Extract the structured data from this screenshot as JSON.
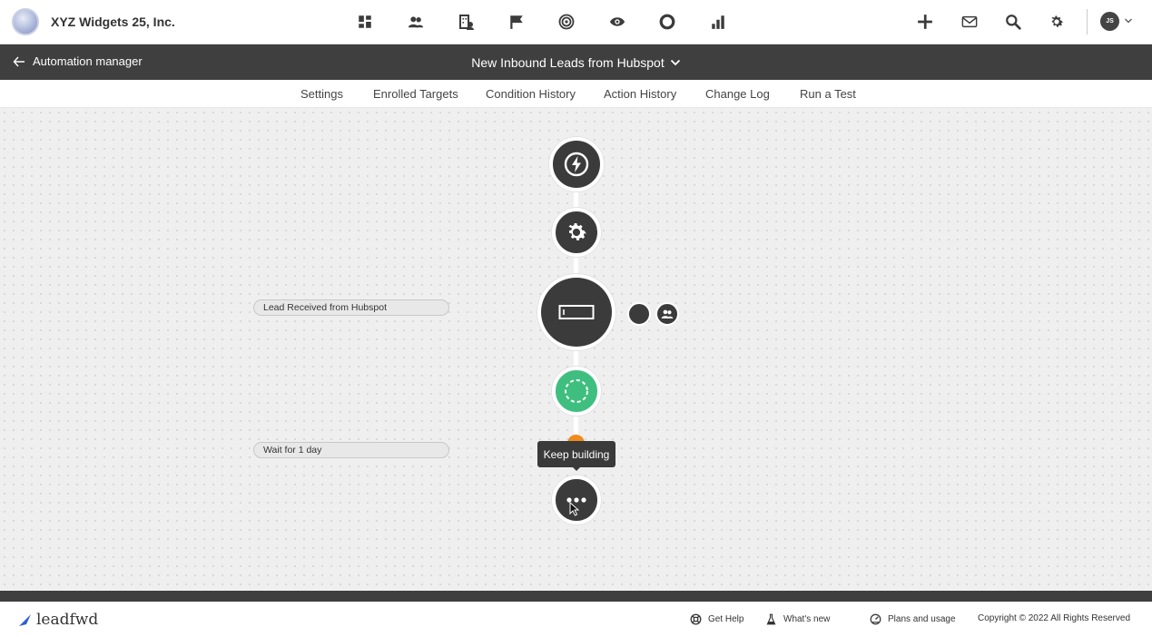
{
  "header": {
    "company_name": "XYZ Widgets 25, Inc.",
    "nav_icons": [
      "dashboard-icon",
      "contacts-icon",
      "accounts-icon",
      "flag-icon",
      "target-icon",
      "eye-icon",
      "circle-icon",
      "bar-chart-icon"
    ],
    "right_icons": [
      "plus-icon",
      "mail-icon",
      "search-icon",
      "gear-icon"
    ],
    "user_initials": "JS"
  },
  "subheader": {
    "back_label": "Automation manager",
    "workflow_title": "New Inbound Leads from Hubspot"
  },
  "tabs": [
    {
      "label": "Settings"
    },
    {
      "label": "Enrolled Targets"
    },
    {
      "label": "Condition History"
    },
    {
      "label": "Action History"
    },
    {
      "label": "Change Log"
    },
    {
      "label": "Run a Test"
    }
  ],
  "workflow": {
    "steps": [
      {
        "icon": "lightning-bolt-icon"
      },
      {
        "icon": "gear-icon"
      },
      {
        "icon": "form-field-icon",
        "label": "Lead Received from Hubspot"
      },
      {
        "icon": "dashed-circle-icon",
        "label": "Wait for 1 day"
      },
      {
        "icon": "more-options-icon"
      }
    ],
    "tooltip": "Keep building"
  },
  "footer": {
    "brand": "leadfwd",
    "links": [
      {
        "icon": "lifebuoy-icon",
        "label": "Get Help"
      },
      {
        "icon": "flask-icon",
        "label": "What's new"
      },
      {
        "icon": "gauge-icon",
        "label": "Plans and usage"
      }
    ],
    "copyright": "Copyright © 2022 All Rights Reserved"
  },
  "colors": {
    "dark": "#3f3f3f",
    "node_dark": "#3b3b3b",
    "node_green": "#3fbf7f",
    "accent_orange": "#f08a1c",
    "canvas_bg": "#efefef"
  }
}
